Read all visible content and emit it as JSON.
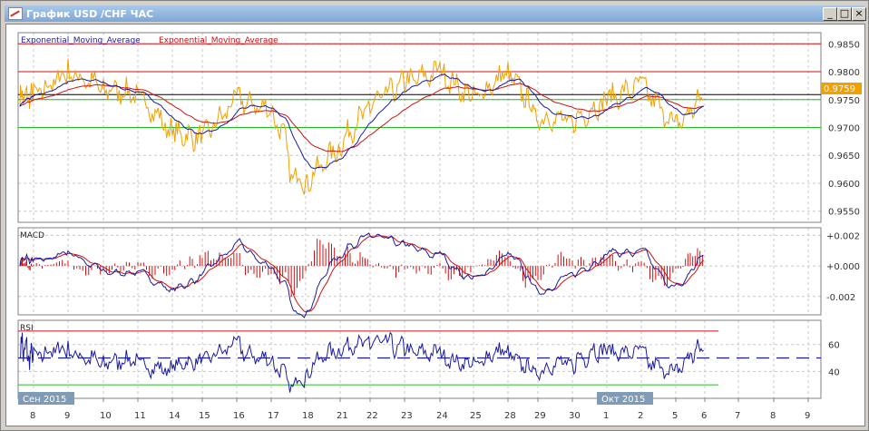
{
  "window": {
    "title": "График USD /CHF  ЧАС",
    "buttons": [
      "_",
      "□",
      "×"
    ]
  },
  "main_panel": {
    "legend": [
      "Exponential_Moving_Average",
      "Exponential_Moving_Average"
    ],
    "y_ticks": [
      "0.9850",
      "0.9800",
      "0.9750",
      "0.9700",
      "0.9650",
      "0.9600",
      "0.9550"
    ],
    "current_price": "0.9759"
  },
  "macd_panel": {
    "label": "MACD",
    "y_ticks": [
      "+0.002",
      "+0.000",
      "-0.002"
    ]
  },
  "rsi_panel": {
    "label": "RSI",
    "y_ticks": [
      "60",
      "40"
    ]
  },
  "x_axis": {
    "labels": [
      "8",
      "9",
      "10",
      "11",
      "14",
      "15",
      "16",
      "17",
      "18",
      "21",
      "22",
      "23",
      "24",
      "25",
      "28",
      "29",
      "30",
      "1",
      "2",
      "5",
      "6",
      "7",
      "8",
      "9"
    ],
    "months": [
      "Сен 2015",
      "Окт 2015"
    ]
  },
  "colors": {
    "price": "#f0a000",
    "ema_fast": "#1a1aa0",
    "ema_slow": "#d01010",
    "level_red": "#d01010",
    "level_green": "#20c020",
    "macd_hist": "#d01010"
  },
  "chart_data": {
    "type": "line",
    "title": "USD/CHF H1",
    "days": [
      "8",
      "9",
      "10",
      "11",
      "14",
      "15",
      "16",
      "17",
      "18",
      "21",
      "22",
      "23",
      "24",
      "25",
      "28",
      "29",
      "30",
      "1",
      "2",
      "5",
      "6"
    ],
    "close": [
      0.9755,
      0.98,
      0.977,
      0.976,
      0.969,
      0.968,
      0.975,
      0.973,
      0.96,
      0.967,
      0.974,
      0.978,
      0.98,
      0.975,
      0.98,
      0.972,
      0.971,
      0.975,
      0.9775,
      0.97,
      0.9759
    ],
    "price_levels": {
      "red": [
        0.985,
        0.98
      ],
      "green": [
        0.975,
        0.97
      ],
      "current": 0.9759
    },
    "ylim": [
      0.953,
      0.987
    ],
    "macd_ylim": [
      -0.0032,
      0.0025
    ],
    "rsi_levels": {
      "upper": 70,
      "lower": 30,
      "mid": 50
    },
    "rsi_ylim": [
      20,
      78
    ]
  }
}
